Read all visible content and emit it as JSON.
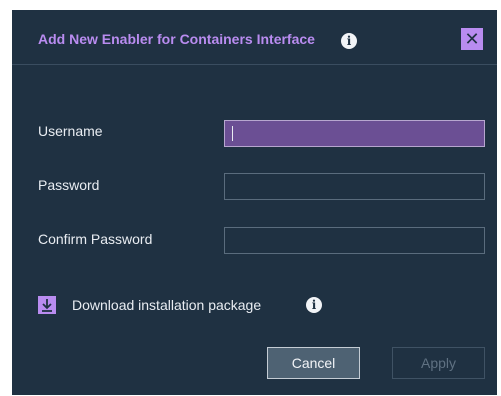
{
  "dialog": {
    "title": "Add New Enabler for Containers Interface",
    "title_info_icon": "info-icon",
    "close_icon": "close-icon"
  },
  "form": {
    "username_label": "Username",
    "username_value": "",
    "password_label": "Password",
    "password_value": "",
    "confirm_password_label": "Confirm Password",
    "confirm_password_value": ""
  },
  "download": {
    "label": "Download installation package",
    "icon": "download-icon",
    "info_icon": "info-icon"
  },
  "buttons": {
    "cancel_label": "Cancel",
    "apply_label": "Apply",
    "apply_enabled": false
  },
  "colors": {
    "dialog_background": "#1f3142",
    "accent": "#b98cf0",
    "active_field": "#6b4f94"
  }
}
